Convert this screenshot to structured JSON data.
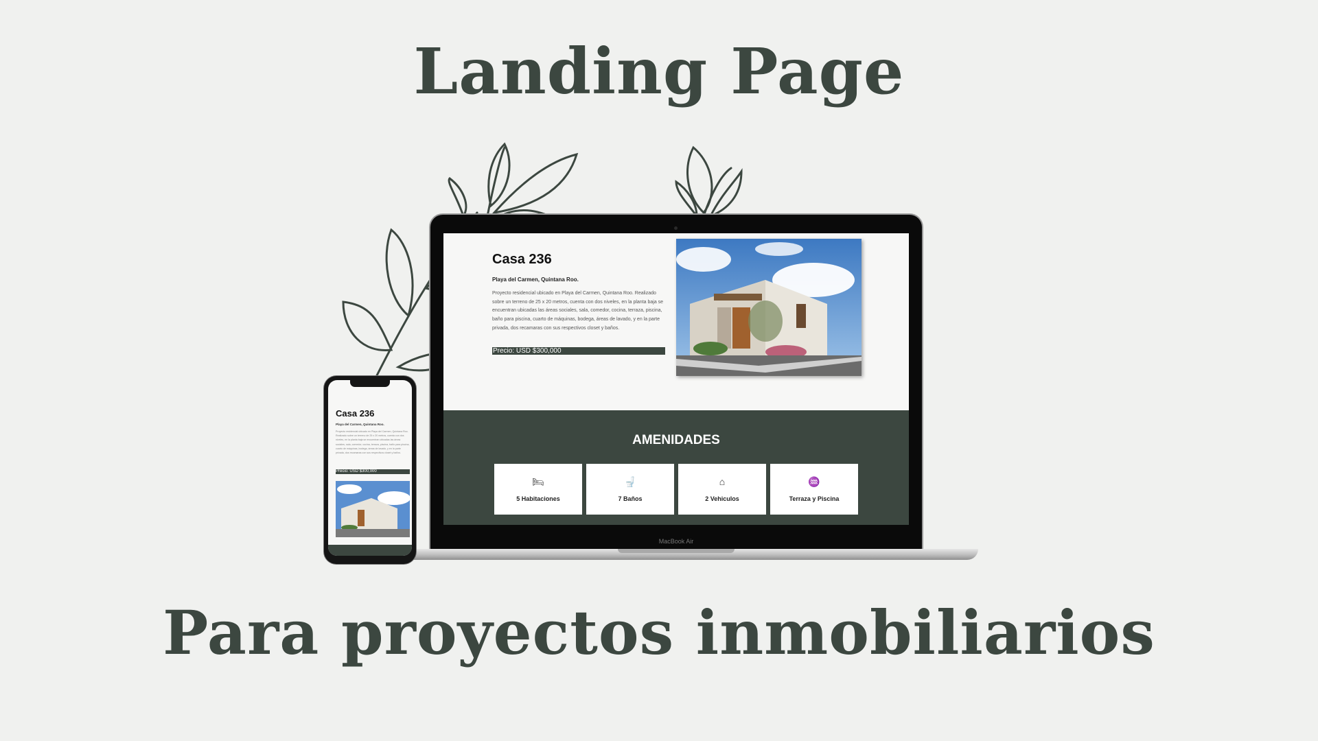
{
  "headline": {
    "title": "Landing Page",
    "subtitle": "Para proyectos inmobiliarios"
  },
  "laptop": {
    "label": "MacBook Air",
    "hero": {
      "title": "Casa 236",
      "location": "Playa del Carmen, Quintana Roo.",
      "description": "Proyecto residencial ubicado en Playa del Carmen, Quintana Roo. Realizado sobre un terreno de 25 x 20 metros, cuenta con dos niveles, en la planta baja se encuentran ubicadas las áreas sociales, sala, comedor, cocina, terraza, piscina, baño para piscina, cuarto de máquinas, bodega, áreas de lavado, y en la parte privada, dos recamaras con sus respectivos closet y baños.",
      "price": "Precio: USD $300,000"
    },
    "amenities": {
      "title": "AMENIDADES",
      "items": [
        {
          "label": "5 Habitaciones",
          "icon": "bed-icon"
        },
        {
          "label": "7 Baños",
          "icon": "toilet-icon"
        },
        {
          "label": "2 Vehiculos",
          "icon": "garage-icon"
        },
        {
          "label": "Terraza y Piscina",
          "icon": "pool-icon"
        }
      ]
    }
  },
  "phone": {
    "title": "Casa 236",
    "location": "Playa del Carmen, Quintana Roo.",
    "price": "Precio: USD $300,000"
  },
  "colors": {
    "accent": "#3c4740",
    "background": "#f0f1ef"
  }
}
